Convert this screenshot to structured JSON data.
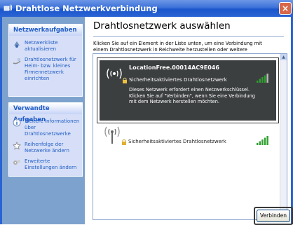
{
  "window": {
    "title": "Drahtlose Netzwerkverbindung",
    "close_glyph": "×"
  },
  "sidebar": {
    "tasks_header": "Netzwerkaufgaben",
    "tasks": [
      {
        "label": "Netzwerkliste aktualisieren",
        "icon": "refresh-icon"
      },
      {
        "label": "Drahtlosnetzwerk für Heim- bzw. kleines Firmennetzwerk einrichten",
        "icon": "setup-network-icon"
      }
    ],
    "related_header": "Verwandte Aufgaben",
    "related": [
      {
        "label": "Weitere Informationen über Drahtlosnetzwerke",
        "icon": "info-icon"
      },
      {
        "label": "Reihenfolge der Netzwerke ändern",
        "icon": "star-icon"
      },
      {
        "label": "Erweiterte Einstellungen ändern",
        "icon": "settings-icon"
      }
    ]
  },
  "main": {
    "heading": "Drahtlosnetzwerk auswählen",
    "instructions": "Klicken Sie auf ein Element in der Liste unten, um eine Verbindung mit einem Drahtlosnetzwerk in Reichweite herzustellen oder weitere Informationen zu erhalten."
  },
  "networks": [
    {
      "name": "LocationFree.00014AC9E046",
      "security": "Sicherheitsaktiviertes Drahtlosnetzwerk",
      "description": "Dieses Netzwerk erfordert einen Netzwerkschlüssel. Klicken Sie auf \"Verbinden\", wenn Sie eine Verbindung mit dem Netzwerk herstellen möchten.",
      "signal": 0.8,
      "selected": true
    },
    {
      "name": "",
      "security": "Sicherheitsaktiviertes Drahtlosnetzwerk",
      "signal": 1.0,
      "selected": false
    }
  ],
  "scrollbar": {
    "up_glyph": "▲",
    "down_glyph": "▼"
  },
  "buttons": {
    "connect": "Verbinden"
  },
  "colors": {
    "titlebar": "#2a63d3",
    "sidebar": "#7da2ce",
    "panel_head_text": "#215dc6",
    "selected_bg": "#3c3f40",
    "signal_green": "#2f9e2f"
  }
}
